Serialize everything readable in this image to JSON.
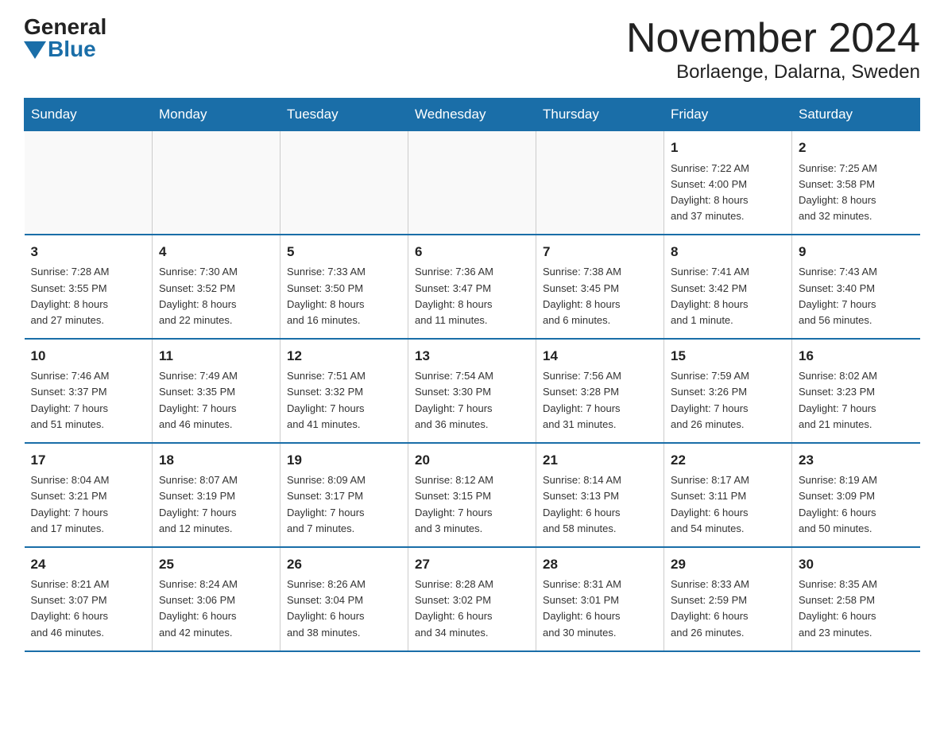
{
  "logo": {
    "general": "General",
    "blue": "Blue"
  },
  "title": {
    "month_year": "November 2024",
    "location": "Borlaenge, Dalarna, Sweden"
  },
  "days_of_week": [
    "Sunday",
    "Monday",
    "Tuesday",
    "Wednesday",
    "Thursday",
    "Friday",
    "Saturday"
  ],
  "weeks": [
    [
      {
        "day": "",
        "info": ""
      },
      {
        "day": "",
        "info": ""
      },
      {
        "day": "",
        "info": ""
      },
      {
        "day": "",
        "info": ""
      },
      {
        "day": "",
        "info": ""
      },
      {
        "day": "1",
        "info": "Sunrise: 7:22 AM\nSunset: 4:00 PM\nDaylight: 8 hours\nand 37 minutes."
      },
      {
        "day": "2",
        "info": "Sunrise: 7:25 AM\nSunset: 3:58 PM\nDaylight: 8 hours\nand 32 minutes."
      }
    ],
    [
      {
        "day": "3",
        "info": "Sunrise: 7:28 AM\nSunset: 3:55 PM\nDaylight: 8 hours\nand 27 minutes."
      },
      {
        "day": "4",
        "info": "Sunrise: 7:30 AM\nSunset: 3:52 PM\nDaylight: 8 hours\nand 22 minutes."
      },
      {
        "day": "5",
        "info": "Sunrise: 7:33 AM\nSunset: 3:50 PM\nDaylight: 8 hours\nand 16 minutes."
      },
      {
        "day": "6",
        "info": "Sunrise: 7:36 AM\nSunset: 3:47 PM\nDaylight: 8 hours\nand 11 minutes."
      },
      {
        "day": "7",
        "info": "Sunrise: 7:38 AM\nSunset: 3:45 PM\nDaylight: 8 hours\nand 6 minutes."
      },
      {
        "day": "8",
        "info": "Sunrise: 7:41 AM\nSunset: 3:42 PM\nDaylight: 8 hours\nand 1 minute."
      },
      {
        "day": "9",
        "info": "Sunrise: 7:43 AM\nSunset: 3:40 PM\nDaylight: 7 hours\nand 56 minutes."
      }
    ],
    [
      {
        "day": "10",
        "info": "Sunrise: 7:46 AM\nSunset: 3:37 PM\nDaylight: 7 hours\nand 51 minutes."
      },
      {
        "day": "11",
        "info": "Sunrise: 7:49 AM\nSunset: 3:35 PM\nDaylight: 7 hours\nand 46 minutes."
      },
      {
        "day": "12",
        "info": "Sunrise: 7:51 AM\nSunset: 3:32 PM\nDaylight: 7 hours\nand 41 minutes."
      },
      {
        "day": "13",
        "info": "Sunrise: 7:54 AM\nSunset: 3:30 PM\nDaylight: 7 hours\nand 36 minutes."
      },
      {
        "day": "14",
        "info": "Sunrise: 7:56 AM\nSunset: 3:28 PM\nDaylight: 7 hours\nand 31 minutes."
      },
      {
        "day": "15",
        "info": "Sunrise: 7:59 AM\nSunset: 3:26 PM\nDaylight: 7 hours\nand 26 minutes."
      },
      {
        "day": "16",
        "info": "Sunrise: 8:02 AM\nSunset: 3:23 PM\nDaylight: 7 hours\nand 21 minutes."
      }
    ],
    [
      {
        "day": "17",
        "info": "Sunrise: 8:04 AM\nSunset: 3:21 PM\nDaylight: 7 hours\nand 17 minutes."
      },
      {
        "day": "18",
        "info": "Sunrise: 8:07 AM\nSunset: 3:19 PM\nDaylight: 7 hours\nand 12 minutes."
      },
      {
        "day": "19",
        "info": "Sunrise: 8:09 AM\nSunset: 3:17 PM\nDaylight: 7 hours\nand 7 minutes."
      },
      {
        "day": "20",
        "info": "Sunrise: 8:12 AM\nSunset: 3:15 PM\nDaylight: 7 hours\nand 3 minutes."
      },
      {
        "day": "21",
        "info": "Sunrise: 8:14 AM\nSunset: 3:13 PM\nDaylight: 6 hours\nand 58 minutes."
      },
      {
        "day": "22",
        "info": "Sunrise: 8:17 AM\nSunset: 3:11 PM\nDaylight: 6 hours\nand 54 minutes."
      },
      {
        "day": "23",
        "info": "Sunrise: 8:19 AM\nSunset: 3:09 PM\nDaylight: 6 hours\nand 50 minutes."
      }
    ],
    [
      {
        "day": "24",
        "info": "Sunrise: 8:21 AM\nSunset: 3:07 PM\nDaylight: 6 hours\nand 46 minutes."
      },
      {
        "day": "25",
        "info": "Sunrise: 8:24 AM\nSunset: 3:06 PM\nDaylight: 6 hours\nand 42 minutes."
      },
      {
        "day": "26",
        "info": "Sunrise: 8:26 AM\nSunset: 3:04 PM\nDaylight: 6 hours\nand 38 minutes."
      },
      {
        "day": "27",
        "info": "Sunrise: 8:28 AM\nSunset: 3:02 PM\nDaylight: 6 hours\nand 34 minutes."
      },
      {
        "day": "28",
        "info": "Sunrise: 8:31 AM\nSunset: 3:01 PM\nDaylight: 6 hours\nand 30 minutes."
      },
      {
        "day": "29",
        "info": "Sunrise: 8:33 AM\nSunset: 2:59 PM\nDaylight: 6 hours\nand 26 minutes."
      },
      {
        "day": "30",
        "info": "Sunrise: 8:35 AM\nSunset: 2:58 PM\nDaylight: 6 hours\nand 23 minutes."
      }
    ]
  ]
}
